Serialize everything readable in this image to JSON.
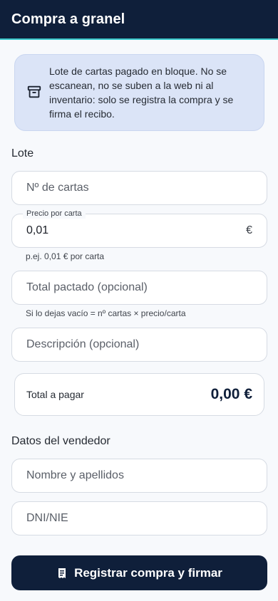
{
  "appbar": {
    "title": "Compra a granel"
  },
  "info": {
    "icon": "archive-box-icon",
    "text": "Lote de cartas pagado en bloque. No se escanean, no se suben a la web ni al inventario: solo se registra la compra y se firma el recibo."
  },
  "lote": {
    "section_label": "Lote",
    "num_cartas": {
      "placeholder": "Nº de cartas",
      "value": ""
    },
    "precio_carta": {
      "label": "Precio por carta",
      "value": "0,01",
      "suffix": "€",
      "helper": "p.ej. 0,01 € por carta"
    },
    "total_pactado": {
      "placeholder": "Total pactado (opcional)",
      "value": "",
      "helper": "Si lo dejas vacío = nº cartas × precio/carta"
    },
    "descripcion": {
      "placeholder": "Descripción (opcional)",
      "value": ""
    }
  },
  "total": {
    "label": "Total a pagar",
    "value": "0,00 €"
  },
  "vendedor": {
    "section_label": "Datos del vendedor",
    "nombre": {
      "placeholder": "Nombre y apellidos",
      "value": ""
    },
    "dni": {
      "placeholder": "DNI/NIE",
      "value": ""
    }
  },
  "submit": {
    "label": "Registrar compra y firmar",
    "icon": "receipt-icon"
  },
  "colors": {
    "primary": "#0f1f3a",
    "accent": "#38c6c9",
    "info_bg": "#dbe4f7"
  }
}
